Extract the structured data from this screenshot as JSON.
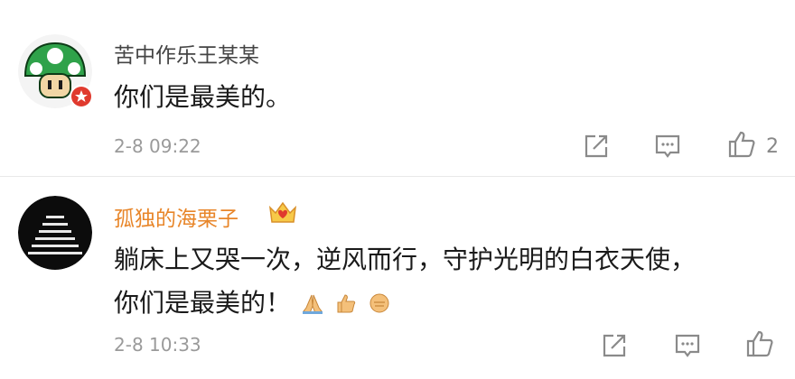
{
  "comments": [
    {
      "username": "苦中作乐王某某",
      "text": "你们是最美的。",
      "time": "2-8 09:22",
      "likes": "2",
      "username_color": "#444444",
      "avatar_icon": "green-mushroom-avatar",
      "badge_icon": "red-verified-badge"
    },
    {
      "username": "孤独的海栗子",
      "text_line1": "躺床上又哭一次，逆风而行，守护光明的白衣天使，",
      "text_line2": "你们是最美的！",
      "time": "2-8 10:33",
      "username_color": "#e8862a",
      "avatar_icon": "black-stairs-avatar",
      "badge_icon": "vip-crown-badge",
      "emojis": [
        "pray-emoji",
        "thumbs-up-emoji",
        "fist-emoji"
      ]
    }
  ],
  "colors": {
    "text": "#1a1a1a",
    "muted": "#9a9a9a",
    "icon": "#8a8a8a",
    "accent_orange": "#e8862a",
    "badge_red": "#e03a2e"
  }
}
